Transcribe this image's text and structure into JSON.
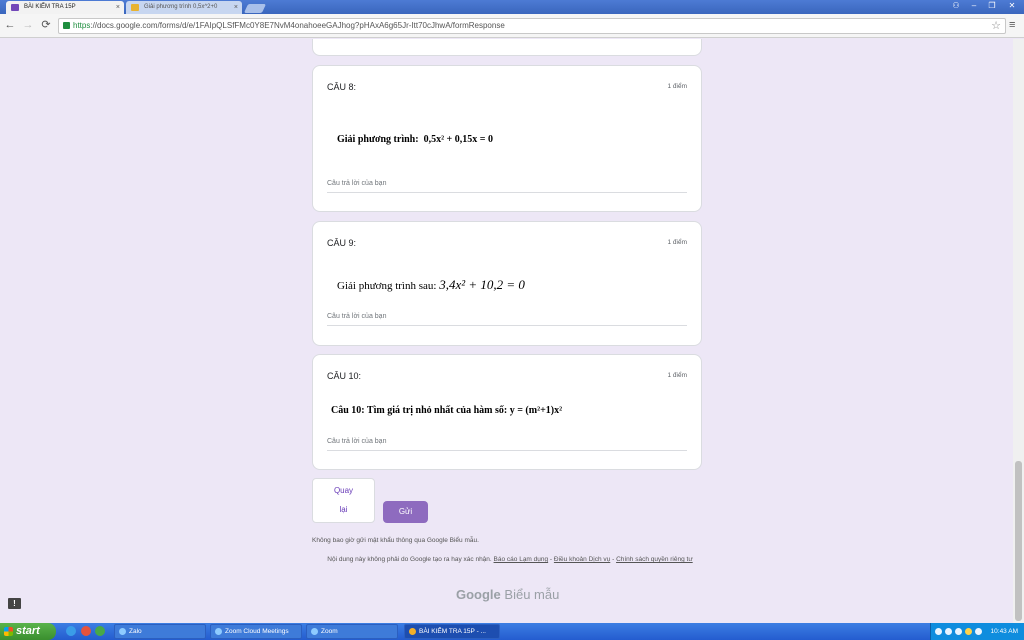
{
  "browser": {
    "tabs": [
      {
        "label": "BÀI KIỂM TRA 15P",
        "active": true
      },
      {
        "label": "Giải phương trình 0,5x^2+0",
        "active": false
      }
    ],
    "tab_close_glyph": "×",
    "url_scheme": "https",
    "url_rest": "://docs.google.com/forms/d/e/1FAIpQLSfFMc0Y8E7NvM4onahoeeGAJhog?pHAxA6g65Jr-Itt70cJhwA/formResponse",
    "window_controls": {
      "user": "⚇",
      "min": "–",
      "max": "❐",
      "close": "✕"
    },
    "nav": {
      "back": "←",
      "forward": "→",
      "reload": "⟳",
      "star": "☆",
      "menu": "≡"
    }
  },
  "form": {
    "questions": [
      {
        "title": "CÂU 8:",
        "points": "1 điểm",
        "prompt_prefix": "Giải phương trình:",
        "equation": "0,5x² + 0,15x = 0",
        "answer_placeholder": "Câu trả lời của bạn"
      },
      {
        "title": "CÂU 9:",
        "points": "1 điểm",
        "prompt_prefix": "Giải phương trình sau:",
        "equation": "3,4x² + 10,2 = 0",
        "answer_placeholder": "Câu trả lời của bạn"
      },
      {
        "title": "CÂU 10:",
        "points": "1 điểm",
        "prompt_prefix": "Câu 10: Tìm giá trị nhỏ nhất của hàm số:",
        "equation": "y = (m²+1)x²",
        "answer_placeholder": "Câu trả lời của bạn"
      }
    ],
    "back_button": {
      "line1": "Quay",
      "line2": "lại"
    },
    "submit_button": "Gửi",
    "password_warning": "Không bao giờ gửi mật khẩu thông qua Google Biểu mẫu.",
    "disclaimer_text": "Nội dung này không phải do Google tạo ra hay xác nhận.",
    "report_link": "Báo cáo Lạm dụng",
    "sep1": " - ",
    "terms_link": "Điều khoản Dịch vụ",
    "sep2": " - ",
    "privacy_link": "Chính sách quyền riêng tư",
    "logo_google": "Google",
    "logo_product": "Biểu mẫu",
    "feedback_glyph": "!"
  },
  "taskbar": {
    "start_label": "start",
    "buttons": [
      "Zalo",
      "Zoom Cloud Meetings",
      "Zoom",
      "BÀI KIỂM TRA 15P - ..."
    ],
    "clock": "10:43 AM"
  },
  "colors": {
    "page_bg": "#ede7f6",
    "accent": "#673ab7",
    "submit": "#8e6bbf"
  }
}
